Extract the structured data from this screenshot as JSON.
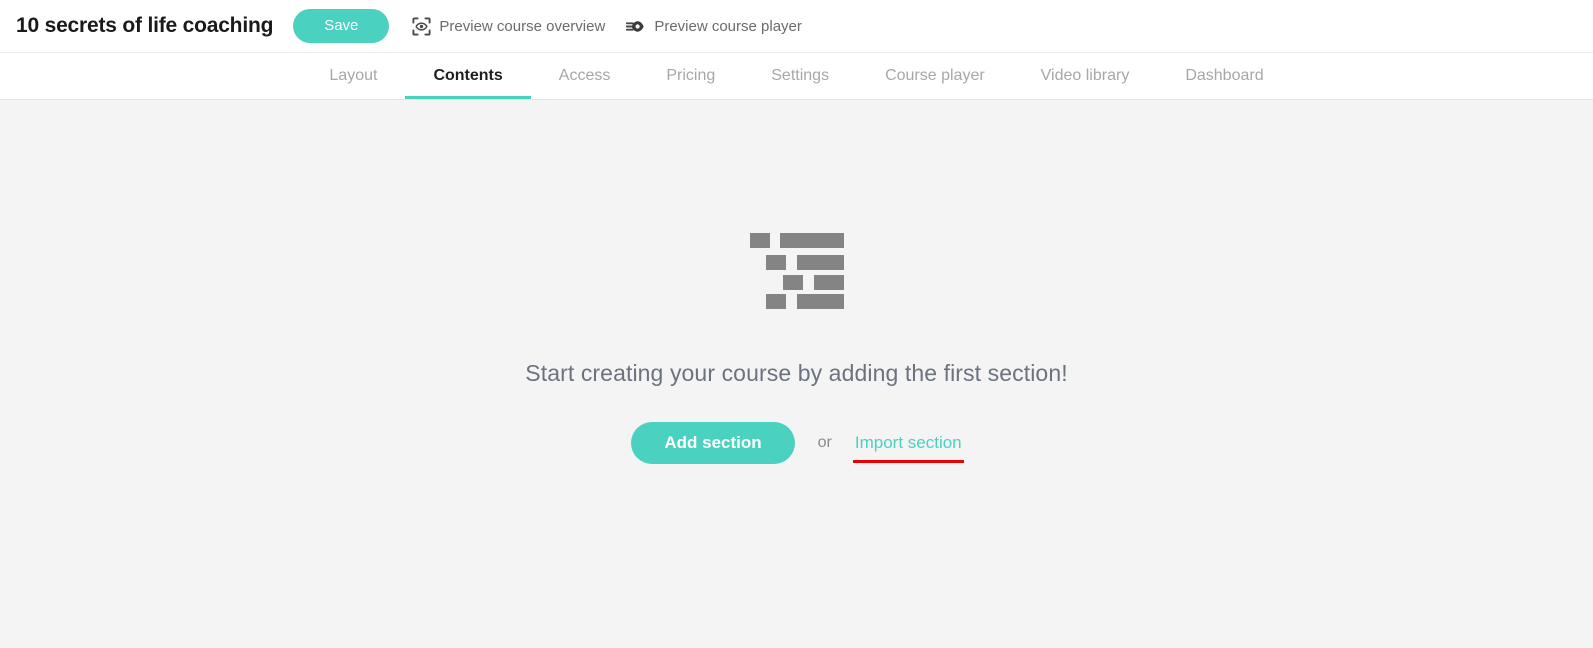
{
  "topbar": {
    "course_title": "10 secrets of life coaching",
    "save_label": "Save",
    "preview_overview_label": "Preview course overview",
    "preview_overview_icon": "eye-in-frame-icon",
    "preview_player_label": "Preview course player",
    "preview_player_icon": "eye-with-motion-lines-icon"
  },
  "tabs": {
    "active": "Contents",
    "items": [
      {
        "label": "Layout"
      },
      {
        "label": "Contents"
      },
      {
        "label": "Access"
      },
      {
        "label": "Pricing"
      },
      {
        "label": "Settings"
      },
      {
        "label": "Course player"
      },
      {
        "label": "Video library"
      },
      {
        "label": "Dashboard"
      }
    ]
  },
  "empty_state": {
    "illustration_icon": "outline-list-placeholder-icon",
    "headline": "Start creating your course by adding the first section!",
    "add_section_label": "Add section",
    "or_label": "or",
    "import_section_label": "Import section"
  },
  "colors": {
    "accent_teal": "#4ad1c0",
    "annotation_red": "#ef0000",
    "page_background": "#f4f4f4",
    "header_background": "#ffffff",
    "illustration_gray": "#848484",
    "muted_text": "#a7a7a7",
    "headline_text": "#6b7280"
  }
}
